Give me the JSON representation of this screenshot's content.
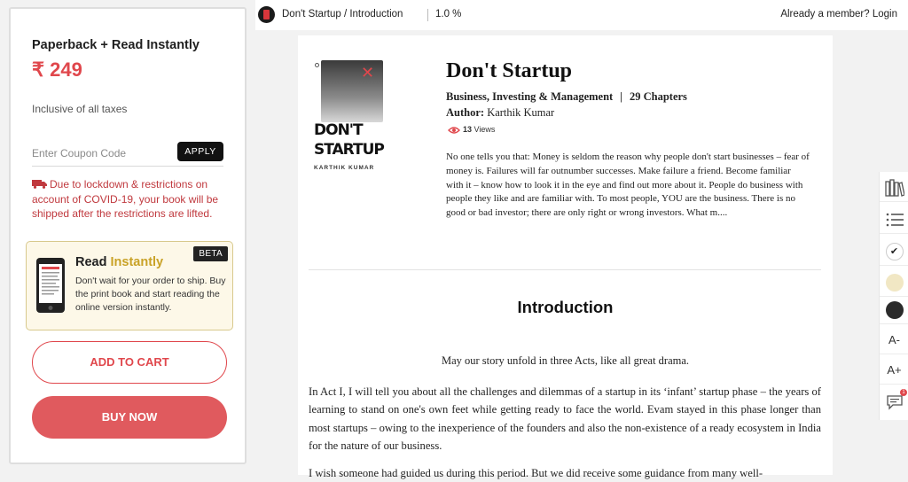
{
  "purchase": {
    "title": "Paperback + Read Instantly",
    "price": "₹ 249",
    "tax_note": "Inclusive of all taxes",
    "coupon_placeholder": "Enter Coupon Code",
    "apply_label": "APPLY",
    "covid_notice": "Due to lockdown & restrictions on account of COVID-19, your book will be shipped after the restrictions are lifted.",
    "read_box": {
      "title_plain": "Read ",
      "title_accent": "Instantly",
      "badge": "BETA",
      "description": "Don't wait for your order to ship. Buy the print book and start reading the online version instantly."
    },
    "add_to_cart_label": "ADD TO CART",
    "buy_now_label": "BUY NOW"
  },
  "topbar": {
    "breadcrumb": "Don't Startup / Introduction",
    "progress": "1.0 %",
    "login": "Already a member? Login"
  },
  "book": {
    "cover_line1": "DON'T",
    "cover_line2": "STARTUP",
    "cover_author": "KARTHIK KUMAR",
    "title": "Don't Startup",
    "category": "Business, Investing & Management",
    "meta_separator": "|",
    "chapters": "29 Chapters",
    "author_label": "Author:",
    "author": "Karthik Kumar",
    "views_count": "13",
    "views_label": "Views",
    "blurb": "No one tells you that: Money is seldom the reason why people don't start businesses – fear of money is.  Failures will far outnumber successes. Make failure a friend. Become familiar with it – know how to look it in the eye and find out more about it. People do business with people they like and are familiar with. To most people, YOU are the business.  There is no good or bad investor; there are only right or wrong investors.  What m...."
  },
  "chapter": {
    "title": "Introduction",
    "epigraph": "May our story unfold in three Acts, like all great drama.",
    "paragraph1": "In Act I, I will tell you about all the challenges and dilemmas of a startup in its ‘infant’ startup phase – the years of learning to stand on one's own feet while getting ready to face the world. Evam stayed in this phase longer than most startups – owing to the inexperience of the founders and also the non-existence of a ready ecosystem in India for the nature of our business.",
    "paragraph2": "I wish someone had guided us during this period. But we did receive some guidance from many well-"
  },
  "tools": {
    "check_glyph": "✔",
    "font_decrease": "A-",
    "font_increase": "A+",
    "comments_badge": "1"
  },
  "colors": {
    "accent_red": "#e0474c",
    "gold": "#c9a227",
    "theme_white": "#ffffff",
    "theme_sepia": "#f1e7c4",
    "theme_dark": "#2b2b2b"
  }
}
